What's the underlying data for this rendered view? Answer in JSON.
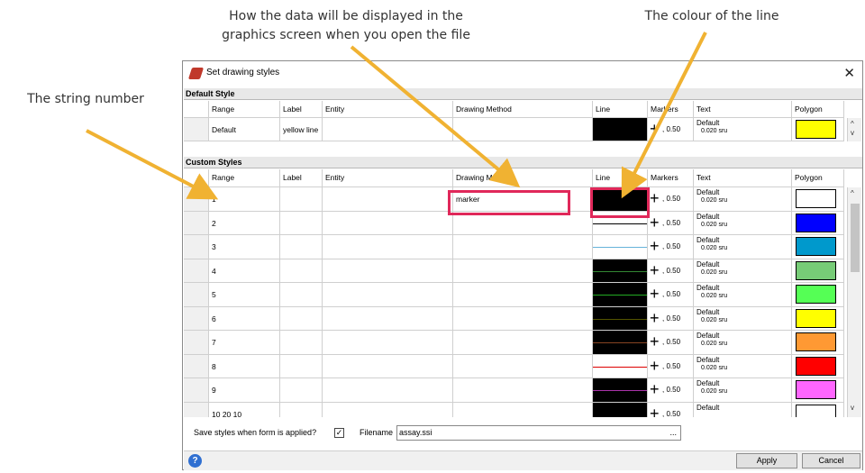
{
  "annotations": {
    "drawing_method": [
      "How the data will be displayed in the",
      "graphics screen when you open the file"
    ],
    "line_colour": "The colour of the line",
    "string_number": "The string number"
  },
  "dialog": {
    "title": "Set drawing styles",
    "close_glyph": "✕",
    "default_section": "Default Style",
    "custom_section": "Custom Styles",
    "columns": [
      "Range",
      "Label",
      "Entity",
      "Drawing Method",
      "Line",
      "Markers",
      "Text",
      "Polygon"
    ],
    "default_row": {
      "range": "Default",
      "label": "yellow line",
      "marker": "+",
      "marker_size": ", 0.50",
      "text1": "Default",
      "text2": "0.020 sru",
      "polygon": "#ffff00"
    },
    "rows": [
      {
        "range": "1",
        "method": "marker",
        "line_bg": "#000000",
        "line_color": "#000000",
        "marker": "+",
        "marker_size": ", 0.50",
        "text1": "Default",
        "text2": "0.020 sru",
        "polygon": "#ffffff"
      },
      {
        "range": "2",
        "method": "",
        "line_bg": "#ffffff",
        "line_color": "#000000",
        "marker": "+",
        "marker_size": ", 0.50",
        "text1": "Default",
        "text2": "0.020 sru",
        "polygon": "#0000ff"
      },
      {
        "range": "3",
        "method": "",
        "line_bg": "#ffffff",
        "line_color": "#66b3d9",
        "marker": "+",
        "marker_size": ", 0.50",
        "text1": "Default",
        "text2": "0.020 sru",
        "polygon": "#0099cc"
      },
      {
        "range": "4",
        "method": "",
        "line_bg": "#000000",
        "line_color": "#338833",
        "marker": "+",
        "marker_size": ", 0.50",
        "text1": "Default",
        "text2": "0.020 sru",
        "polygon": "#77cc77"
      },
      {
        "range": "5",
        "method": "",
        "line_bg": "#000000",
        "line_color": "#22aa22",
        "marker": "+",
        "marker_size": ", 0.50",
        "text1": "Default",
        "text2": "0.020 sru",
        "polygon": "#55ff55"
      },
      {
        "range": "6",
        "method": "",
        "line_bg": "#000000",
        "line_color": "#555500",
        "marker": "+",
        "marker_size": ", 0.50",
        "text1": "Default",
        "text2": "0.020 sru",
        "polygon": "#ffff00"
      },
      {
        "range": "7",
        "method": "",
        "line_bg": "#000000",
        "line_color": "#884422",
        "marker": "+",
        "marker_size": ", 0.50",
        "text1": "Default",
        "text2": "0.020 sru",
        "polygon": "#ff9933"
      },
      {
        "range": "8",
        "method": "",
        "line_bg": "#ffffff",
        "line_color": "#dd0000",
        "marker": "+",
        "marker_size": ", 0.50",
        "text1": "Default",
        "text2": "0.020 sru",
        "polygon": "#ff0000"
      },
      {
        "range": "9",
        "method": "",
        "line_bg": "#000000",
        "line_color": "#aa33aa",
        "marker": "+",
        "marker_size": ", 0.50",
        "text1": "Default",
        "text2": "0.020 sru",
        "polygon": "#ff66ff"
      },
      {
        "range": "10 20 10",
        "method": "",
        "line_bg": "#000000",
        "line_color": "#000000",
        "marker": "+",
        "marker_size": ", 0.50",
        "text1": "Default",
        "text2": "",
        "polygon": "#ffffff"
      }
    ],
    "save_label": "Save styles when form is applied?",
    "save_checked": "✓",
    "filename_label": "Filename",
    "filename_value": "assay.ssi",
    "browse_label": "...",
    "help_glyph": "?",
    "apply_label": "Apply",
    "cancel_label": "Cancel",
    "scroll_up": "^",
    "scroll_down": "v"
  }
}
